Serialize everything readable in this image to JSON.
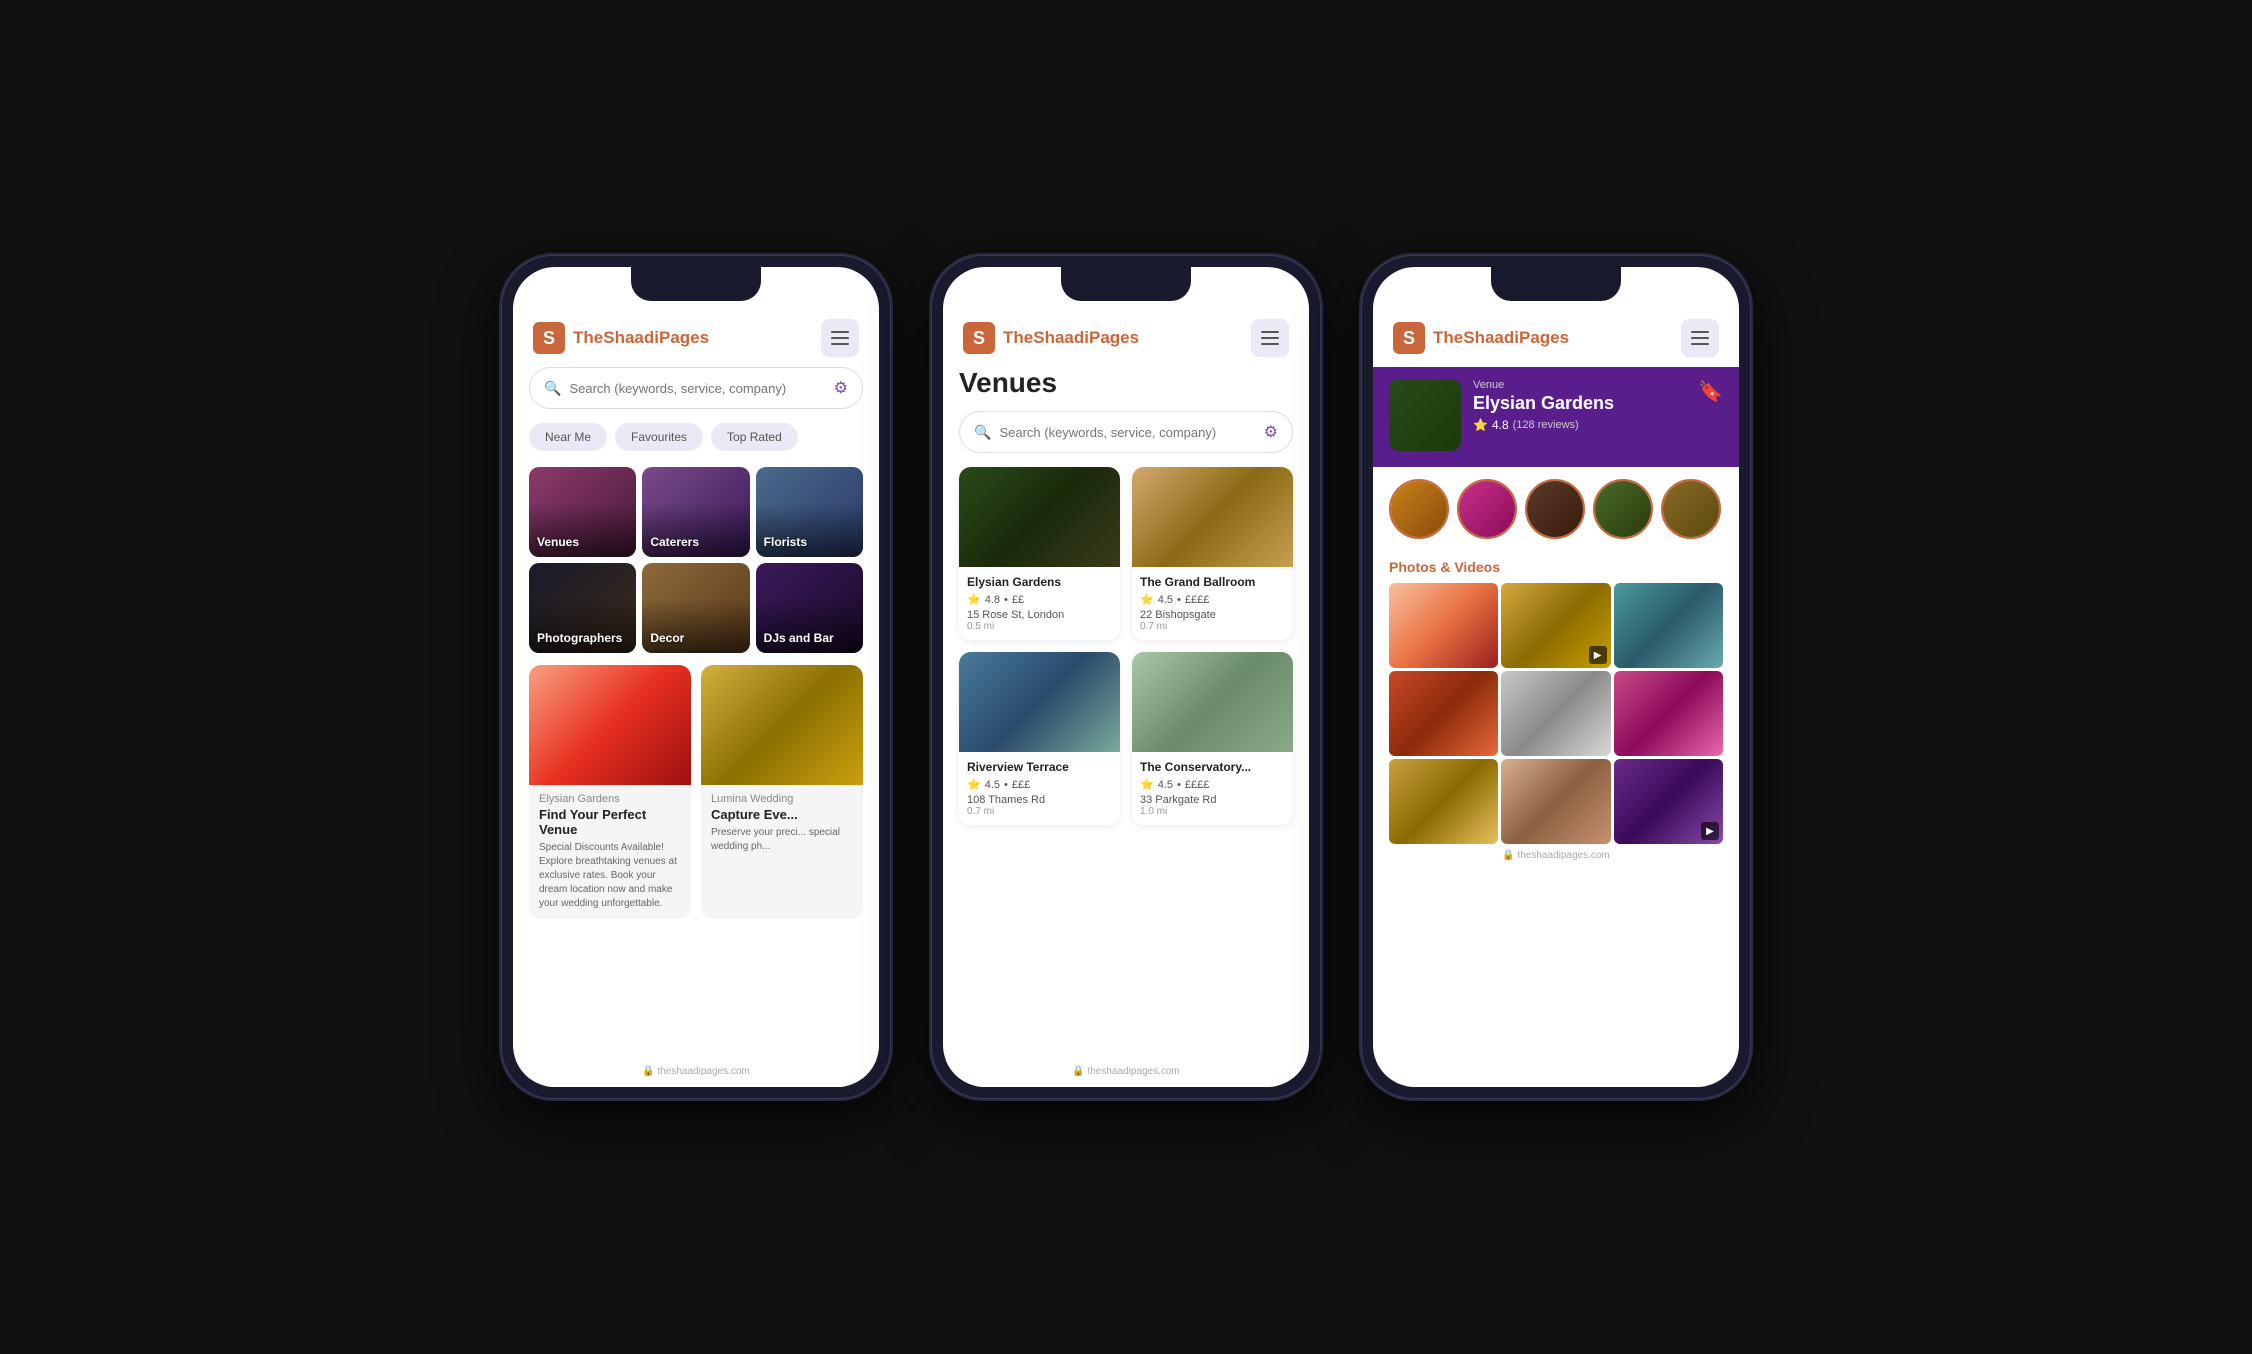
{
  "app": {
    "name": "TheShaadiPages",
    "name_prefix": "The",
    "name_suffix": "ShaadiPages",
    "logo_letter": "S",
    "website": "theshaadipages.com"
  },
  "screen1": {
    "search_placeholder": "Search (keywords, service, company)",
    "quick_filters": [
      "Near Me",
      "Favourites",
      "Top Rated"
    ],
    "categories": [
      {
        "label": "Venues",
        "key": "venues"
      },
      {
        "label": "Caterers",
        "key": "caterers"
      },
      {
        "label": "Florists",
        "key": "florists"
      },
      {
        "label": "Photographers",
        "key": "photographers"
      },
      {
        "label": "Decor",
        "key": "decor"
      },
      {
        "label": "DJs and Bar",
        "key": "djs"
      }
    ],
    "promo": [
      {
        "vendor": "Elysian Gardens",
        "title": "Find Your Perfect Venue",
        "desc": "Special Discounts Available! Explore breathtaking venues at exclusive rates. Book your dream location now and make your wedding unforgettable."
      },
      {
        "vendor": "Lumina Wedding",
        "title": "Capture Eve...",
        "desc": "Preserve your preci... special wedding ph..."
      }
    ]
  },
  "screen2": {
    "page_title": "Venues",
    "search_placeholder": "Search (keywords, service, company)",
    "venues": [
      {
        "name": "Elysian Gardens",
        "rating": "4.8",
        "price": "££",
        "address": "15 Rose St, London",
        "distance": "0.5 mi"
      },
      {
        "name": "The Grand Ballroom",
        "rating": "4.5",
        "price": "££££",
        "address": "22 Bishopsgate",
        "distance": "0.7 mi"
      },
      {
        "name": "Riverview Terrace",
        "rating": "4.5",
        "price": "£££",
        "address": "108 Thames Rd",
        "distance": "0.7 mi"
      },
      {
        "name": "The Conservatory...",
        "rating": "4.5",
        "price": "££££",
        "address": "33 Parkgate Rd",
        "distance": "1.0 mi"
      }
    ]
  },
  "screen3": {
    "vendor": {
      "type": "Venue",
      "name": "Elysian Gardens",
      "rating": "4.8",
      "reviews": "128 reviews"
    },
    "sections": {
      "photos_videos": "Photos & Videos"
    },
    "photo_grid": [
      {
        "key": "photo1",
        "has_play": false
      },
      {
        "key": "photo2",
        "has_play": true
      },
      {
        "key": "photo3",
        "has_play": false
      },
      {
        "key": "photo4",
        "has_play": false
      },
      {
        "key": "photo5",
        "has_play": false
      },
      {
        "key": "photo6",
        "has_play": false
      },
      {
        "key": "photo7",
        "has_play": false
      },
      {
        "key": "photo8",
        "has_play": false
      },
      {
        "key": "photo9",
        "has_play": true
      }
    ]
  }
}
